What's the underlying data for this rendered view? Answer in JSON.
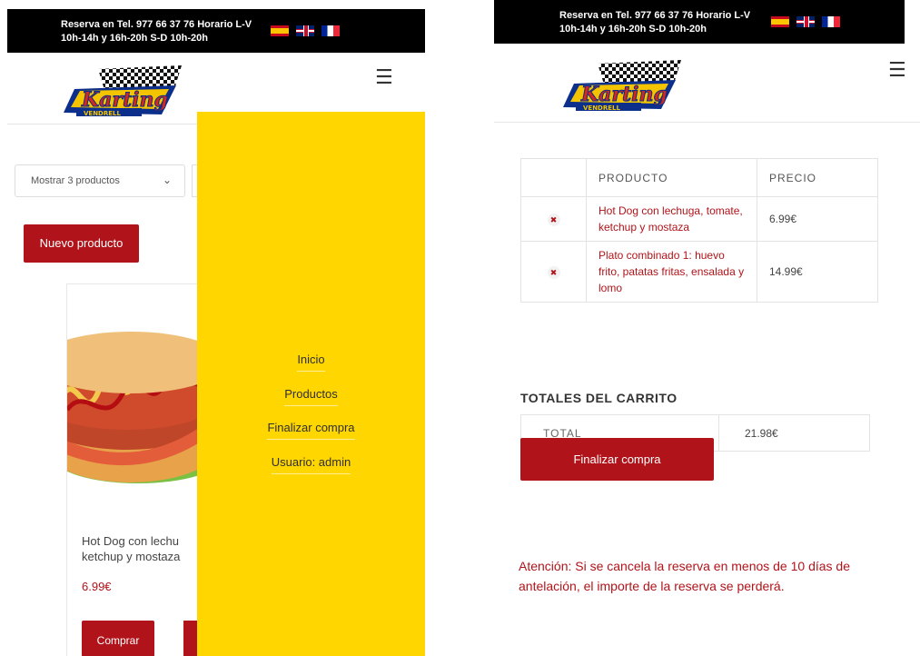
{
  "header": {
    "reservation_text_line1": "Reserva en Tel. 977 66 37 76 Horario L-V",
    "reservation_text_line2": "10h-14h y 16h-20h S-D 10h-20h",
    "languages": [
      "es-flag-icon",
      "uk-flag-icon",
      "fr-flag-icon"
    ],
    "logo_alt": "Karting Vendrell",
    "menu_icon": "☰"
  },
  "left": {
    "sort_select": "Mostrar 3 productos",
    "new_product_label": "Nuevo producto",
    "product": {
      "name": "Hot Dog con lechu ketchup y mostaza",
      "name_line1": "Hot Dog con lechu",
      "name_line2": "ketchup y mostaza",
      "price": "6.99€",
      "buy_label": "Comprar"
    },
    "side_menu": {
      "items": [
        "Inicio",
        "Productos",
        "Finalizar compra",
        "Usuario: admin"
      ]
    }
  },
  "right": {
    "cart": {
      "headers": [
        "",
        "PRODUCTO",
        "PRECIO"
      ],
      "rows": [
        {
          "remove": "✖",
          "product": "Hot Dog con lechuga, tomate, ketchup y mostaza",
          "price": "6.99€"
        },
        {
          "remove": "✖",
          "product": "Plato combinado 1: huevo frito, patatas fritas, ensalada y lomo",
          "price": "14.99€"
        }
      ]
    },
    "totals_title": "TOTALES DEL CARRITO",
    "total_label": "TOTAL",
    "total_value": "21.98€",
    "checkout_label": "Finalizar compra",
    "notice": "Atención: Si se cancela la reserva en menos de 10 días de antelación, el importe de la reserva se perderá."
  },
  "colors": {
    "brand_red": "#b0141a",
    "menu_yellow": "#ffd600",
    "topbar_black": "#000000"
  }
}
